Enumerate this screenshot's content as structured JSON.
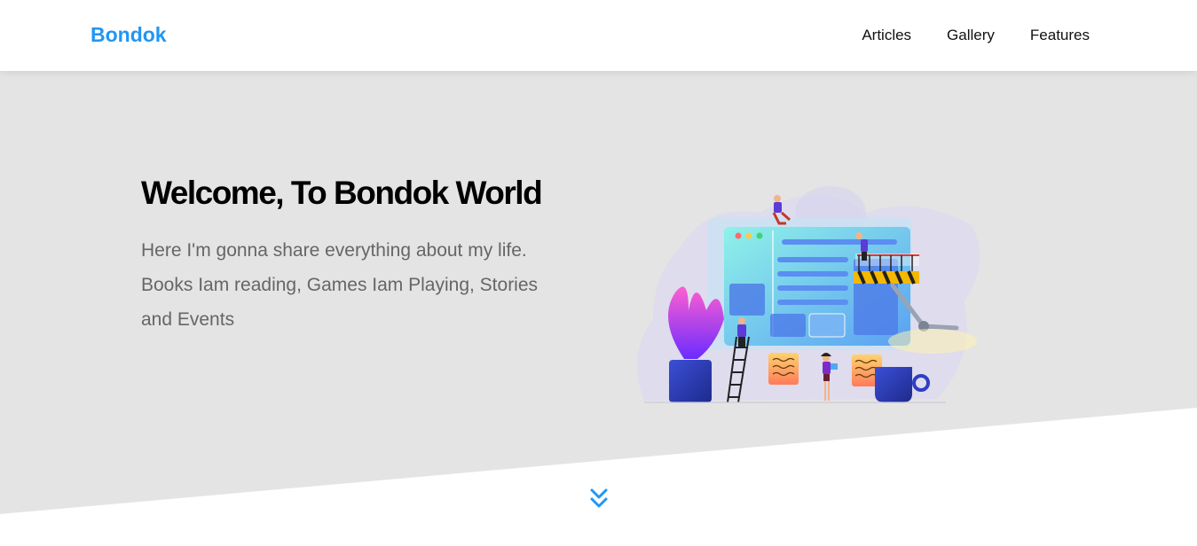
{
  "header": {
    "logo": "Bondok",
    "nav": [
      {
        "label": "Articles"
      },
      {
        "label": "Gallery"
      },
      {
        "label": "Features"
      }
    ]
  },
  "hero": {
    "title": "Welcome, To Bondok World",
    "text": "Here I'm gonna share everything about my life. Books Iam reading, Games Iam Playing, Stories and Events",
    "illustration_icon": "team-building-website-illustration"
  },
  "scroll_down_icon": "double-chevron-down-icon",
  "colors": {
    "accent": "#2196f3",
    "hero_background": "#e4e4e4",
    "title": "#000000",
    "text": "#666666"
  }
}
